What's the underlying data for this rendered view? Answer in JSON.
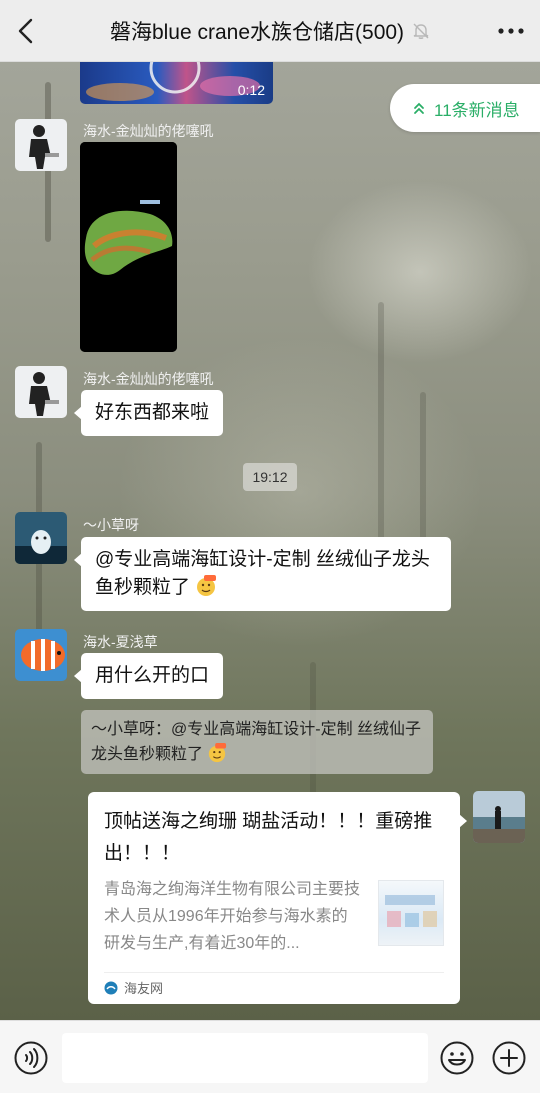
{
  "header": {
    "title": "磐海blue crane水族仓储店(500)",
    "back_icon": "chevron-left-icon",
    "mute_icon": "bell-off-icon",
    "more_icon": "more-dots-icon"
  },
  "new_messages": {
    "label": "11条新消息",
    "icon": "double-chevron-up-icon",
    "color": "#2aae67"
  },
  "messages": [
    {
      "type": "video",
      "duration": "0:12"
    },
    {
      "type": "video",
      "sender": "海水-金灿灿的佬噻吼"
    },
    {
      "type": "text",
      "sender": "海水-金灿灿的佬噻吼",
      "text": "好东西都来啦"
    },
    {
      "type": "time",
      "text": "19:12"
    },
    {
      "type": "text",
      "sender": "〜小草呀",
      "text": "@专业高端海缸设计-定制  丝绒仙子龙头鱼秒颗粒了",
      "emoji": "666-emoji"
    },
    {
      "type": "text",
      "sender": "海水-夏浅草",
      "text": "用什么开的口",
      "quote": "〜小草呀：@专业高端海缸设计-定制 丝绒仙子龙头鱼秒颗粒了",
      "quote_emoji": "666-emoji"
    },
    {
      "type": "link",
      "title": "顶帖送海之绚珊 瑚盐活动！！！重磅推出！！！",
      "description": "青岛海之绚海洋生物有限公司主要技术人员从1996年开始参与海水素的研发与生产,有着近30年的...",
      "source": "海友网"
    }
  ],
  "bottombar": {
    "voice_icon": "voice-icon",
    "emoji_icon": "smiley-icon",
    "plus_icon": "plus-icon"
  }
}
